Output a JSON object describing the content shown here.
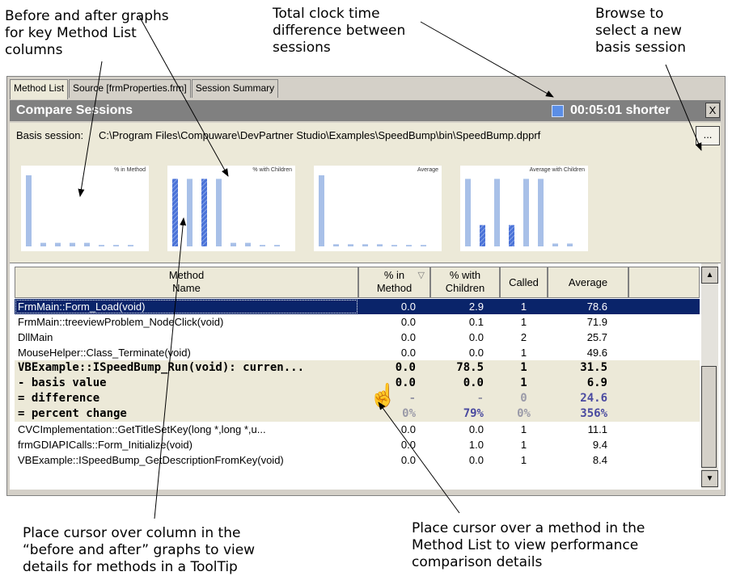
{
  "annotations": {
    "graphs": [
      "Before and after graphs",
      "for key Method List",
      "columns"
    ],
    "clock": [
      "Total clock time",
      "difference between",
      "sessions"
    ],
    "browse": [
      "Browse to",
      "select a new",
      "basis session"
    ],
    "cursor_column": [
      "Place cursor over column in the",
      "“before and after” graphs to view",
      "details for methods in a ToolTip"
    ],
    "cursor_method": [
      "Place cursor over a method in the",
      "Method List to view performance",
      "comparison details"
    ]
  },
  "tabs": [
    "Method List",
    "Source [frmProperties.frm]",
    "Session Summary"
  ],
  "titlebar": {
    "title": "Compare Sessions",
    "difference": "00:05:01 shorter",
    "close": "X"
  },
  "basis": {
    "label": "Basis session:",
    "path": "C:\\Program Files\\Compuware\\DevPartner Studio\\Examples\\SpeedBump\\bin\\SpeedBump.dpprf",
    "browse": "..."
  },
  "graph_titles": [
    "% in Method",
    "% with Children",
    "Average",
    "Average with Children"
  ],
  "graph_bars": [
    [
      1.0,
      0.05,
      0.05,
      0.05,
      0.05,
      0.02,
      0.02,
      0.02
    ],
    [
      0.95,
      0.95,
      0.95,
      0.95,
      0.05,
      0.05,
      0.02,
      0.02
    ],
    [
      1.0,
      0.03,
      0.03,
      0.03,
      0.03,
      0.02,
      0.02,
      0.02
    ],
    [
      0.95,
      0.3,
      0.95,
      0.3,
      0.95,
      0.95,
      0.04,
      0.04
    ]
  ],
  "columns": [
    {
      "line1": "Method",
      "line2": "Name"
    },
    {
      "line1": "% in",
      "line2": "Method"
    },
    {
      "line1": "% with",
      "line2": "Children"
    },
    {
      "line1": "Called",
      "line2": ""
    },
    {
      "line1": "Average",
      "line2": ""
    }
  ],
  "rows": [
    {
      "name": "FrmMain::Form_Load(void)",
      "pct": "0.0",
      "pctc": "2.9",
      "called": "1",
      "avg": "78.6",
      "kind": "sel"
    },
    {
      "name": "FrmMain::treeviewProblem_NodeClick(void)",
      "pct": "0.0",
      "pctc": "0.1",
      "called": "1",
      "avg": "71.9",
      "kind": ""
    },
    {
      "name": "DllMain",
      "pct": "0.0",
      "pctc": "0.0",
      "called": "2",
      "avg": "25.7",
      "kind": ""
    },
    {
      "name": "MouseHelper::Class_Terminate(void)",
      "pct": "0.0",
      "pctc": "0.0",
      "called": "1",
      "avg": "49.6",
      "kind": ""
    },
    {
      "name": "VBExample::ISpeedBump_Run(void): curren...",
      "pct": "0.0",
      "pctc": "78.5",
      "called": "1",
      "avg": "31.5",
      "kind": "grp"
    },
    {
      "name": "  - basis value",
      "pct": "0.0",
      "pctc": "0.0",
      "called": "1",
      "avg": "6.9",
      "kind": "grp"
    },
    {
      "name": "  = difference",
      "pct": "-",
      "pctc": "-",
      "called": "0",
      "avg": "24.6",
      "kind": "grp diffr"
    },
    {
      "name": "  = percent change",
      "pct": "0%",
      "pctc": "79%",
      "called": "0%",
      "avg": "356%",
      "kind": "grp pct"
    },
    {
      "name": "CVCImplementation::GetTitleSetKey(long *,long *,u...",
      "pct": "0.0",
      "pctc": "0.0",
      "called": "1",
      "avg": "11.1",
      "kind": ""
    },
    {
      "name": "frmGDIAPICalls::Form_Initialize(void)",
      "pct": "0.0",
      "pctc": "1.0",
      "called": "1",
      "avg": "9.4",
      "kind": ""
    },
    {
      "name": "VBExample::ISpeedBump_GetDescriptionFromKey(void)",
      "pct": "0.0",
      "pctc": "0.0",
      "called": "1",
      "avg": "8.4",
      "kind": ""
    }
  ],
  "colors": {
    "bar_light": "#a8c0e8",
    "bar_hatch": "#4a72d8",
    "selection": "#0a246a",
    "window": "#d4d0c8"
  },
  "icons": {
    "cursor": "hand-pointer-icon",
    "sort": "sort-descending-icon"
  }
}
